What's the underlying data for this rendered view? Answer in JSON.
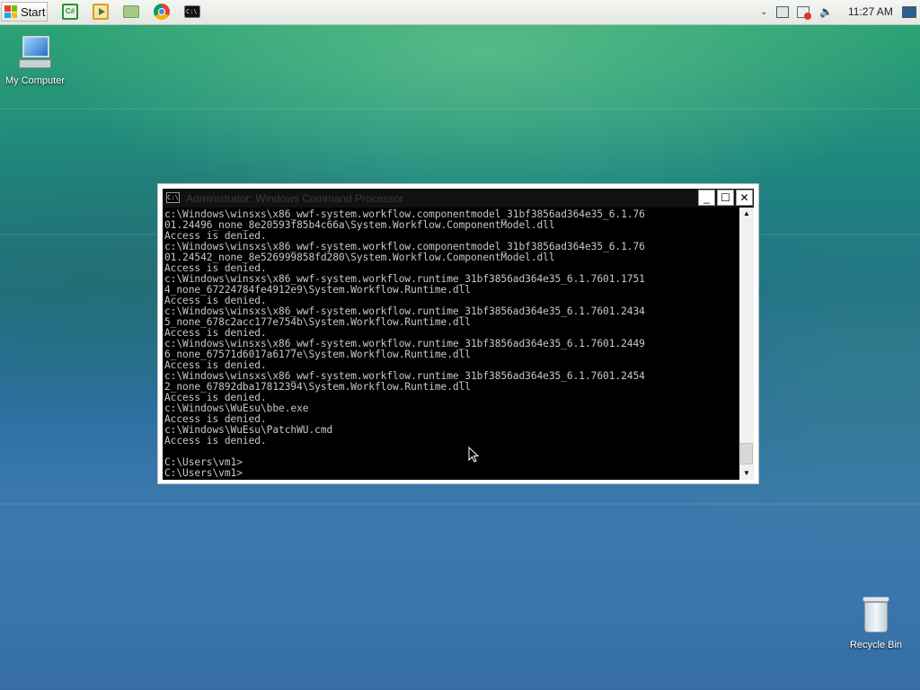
{
  "taskbar": {
    "start_label": "Start",
    "quick_launch": [
      {
        "name": "csharp-icon",
        "color": "#2f8f2f"
      },
      {
        "name": "media-player-icon",
        "color": "#d9a020"
      },
      {
        "name": "explorer-folder-icon",
        "color": "#6fa04e"
      },
      {
        "name": "chrome-icon",
        "color": "#db4437"
      },
      {
        "name": "cmd-icon",
        "color": "#111111"
      }
    ],
    "clock": "11:27 AM"
  },
  "desktop": {
    "my_computer_label": "My Computer",
    "recycle_bin_label": "Recycle Bin"
  },
  "console": {
    "title": "Administrator: Windows Command Processor",
    "minimize_label": "_",
    "maximize_label": "☐",
    "close_label": "✕",
    "output": "c:\\Windows\\winsxs\\x86_wwf-system.workflow.componentmodel_31bf3856ad364e35_6.1.76\n01.24496_none_8e20593f85b4c66a\\System.Workflow.ComponentModel.dll\nAccess is denied.\nc:\\Windows\\winsxs\\x86_wwf-system.workflow.componentmodel_31bf3856ad364e35_6.1.76\n01.24542_none_8e526999858fd280\\System.Workflow.ComponentModel.dll\nAccess is denied.\nc:\\Windows\\winsxs\\x86_wwf-system.workflow.runtime_31bf3856ad364e35_6.1.7601.1751\n4_none_67224784fe4912e9\\System.Workflow.Runtime.dll\nAccess is denied.\nc:\\Windows\\winsxs\\x86_wwf-system.workflow.runtime_31bf3856ad364e35_6.1.7601.2434\n5_none_678c2acc177e754b\\System.Workflow.Runtime.dll\nAccess is denied.\nc:\\Windows\\winsxs\\x86_wwf-system.workflow.runtime_31bf3856ad364e35_6.1.7601.2449\n6_none_67571d6017a6177e\\System.Workflow.Runtime.dll\nAccess is denied.\nc:\\Windows\\winsxs\\x86_wwf-system.workflow.runtime_31bf3856ad364e35_6.1.7601.2454\n2_none_67892dba17812394\\System.Workflow.Runtime.dll\nAccess is denied.\nc:\\Windows\\WuEsu\\bbe.exe\nAccess is denied.\nc:\\Windows\\WuEsu\\PatchWU.cmd\nAccess is denied.\n\nC:\\Users\\vm1>\nC:\\Users\\vm1>"
  }
}
